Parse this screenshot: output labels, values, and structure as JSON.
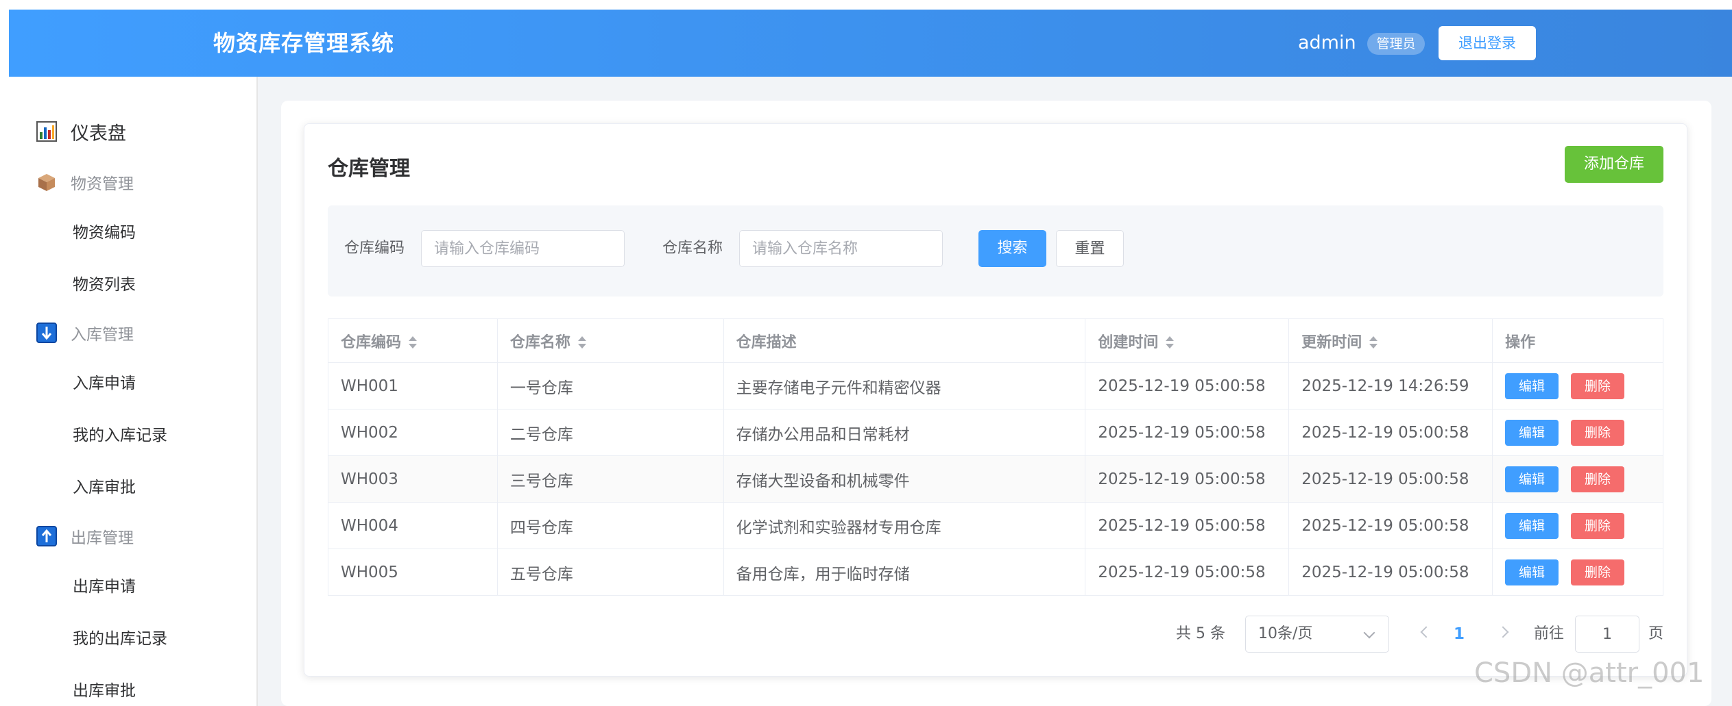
{
  "header": {
    "title": "物资库存管理系统",
    "username": "admin",
    "role": "管理员",
    "logout_label": "退出登录"
  },
  "sidebar": {
    "items": [
      {
        "label": "仪表盘",
        "icon": "bar-chart-icon"
      },
      {
        "label": "物资管理",
        "icon": "box-icon"
      },
      {
        "label": "物资编码"
      },
      {
        "label": "物资列表"
      },
      {
        "label": "入库管理",
        "icon": "down-arrow-icon"
      },
      {
        "label": "入库申请"
      },
      {
        "label": "我的入库记录"
      },
      {
        "label": "入库审批"
      },
      {
        "label": "出库管理",
        "icon": "up-arrow-icon"
      },
      {
        "label": "出库申请"
      },
      {
        "label": "我的出库记录"
      },
      {
        "label": "出库审批"
      }
    ]
  },
  "page": {
    "title": "仓库管理",
    "add_label": "添加仓库"
  },
  "search": {
    "code_label": "仓库编码",
    "code_placeholder": "请输入仓库编码",
    "name_label": "仓库名称",
    "name_placeholder": "请输入仓库名称",
    "search_label": "搜索",
    "reset_label": "重置"
  },
  "table": {
    "headers": [
      "仓库编码",
      "仓库名称",
      "仓库描述",
      "创建时间",
      "更新时间",
      "操作"
    ],
    "edit_label": "编辑",
    "delete_label": "删除",
    "rows": [
      {
        "code": "WH001",
        "name": "一号仓库",
        "desc": "主要存储电子元件和精密仪器",
        "created": "2025-12-19 05:00:58",
        "updated": "2025-12-19 14:26:59"
      },
      {
        "code": "WH002",
        "name": "二号仓库",
        "desc": "存储办公用品和日常耗材",
        "created": "2025-12-19 05:00:58",
        "updated": "2025-12-19 05:00:58"
      },
      {
        "code": "WH003",
        "name": "三号仓库",
        "desc": "存储大型设备和机械零件",
        "created": "2025-12-19 05:00:58",
        "updated": "2025-12-19 05:00:58"
      },
      {
        "code": "WH004",
        "name": "四号仓库",
        "desc": "化学试剂和实验器材专用仓库",
        "created": "2025-12-19 05:00:58",
        "updated": "2025-12-19 05:00:58"
      },
      {
        "code": "WH005",
        "name": "五号仓库",
        "desc": "备用仓库，用于临时存储",
        "created": "2025-12-19 05:00:58",
        "updated": "2025-12-19 05:00:58"
      }
    ]
  },
  "pagination": {
    "total": "共 5 条",
    "page_size": "10条/页",
    "current_page": "1",
    "goto_label": "前往",
    "goto_value": "1",
    "page_suffix": "页"
  },
  "watermark": "CSDN @attr_001",
  "colors": {
    "primary": "#409eff",
    "success": "#67c23a",
    "danger": "#f56c6c"
  }
}
